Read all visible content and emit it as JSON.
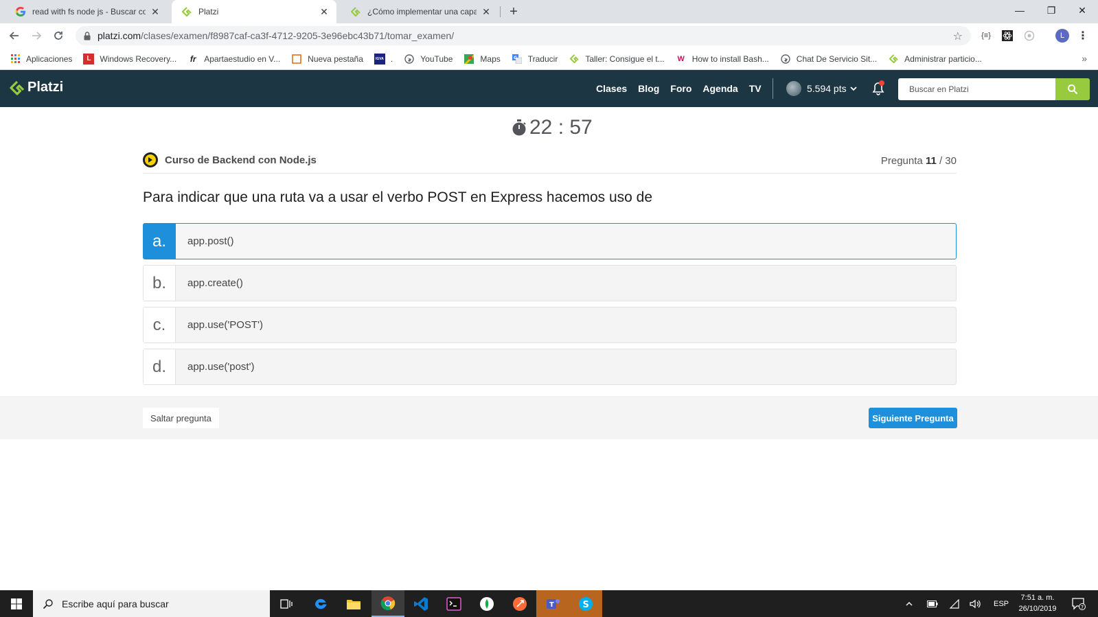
{
  "browser": {
    "tabs": [
      {
        "title": "read with fs node js - Buscar con Google",
        "close": "✕"
      },
      {
        "title": "Platzi",
        "close": "✕"
      },
      {
        "title": "¿Cómo implementar una capa de servicios",
        "close": "✕"
      }
    ],
    "new_tab": "+",
    "window_controls": {
      "minimize": "—",
      "restore": "❐",
      "close": "✕"
    },
    "url_host": "platzi.com",
    "url_path": "/clases/examen/f8987caf-ca3f-4712-9205-3e96ebc43b71/tomar_examen/",
    "profile_initial": "L",
    "extension_label": "{≡}"
  },
  "bookmarks": [
    {
      "label": "Aplicaciones",
      "icon": "apps-grid-icon"
    },
    {
      "label": "Windows Recovery...",
      "icon": "L"
    },
    {
      "label": "Apartaestudio en V...",
      "icon": "fr"
    },
    {
      "label": "Nueva pestaña",
      "icon": "square-icon"
    },
    {
      "label": ".",
      "icon": "IGVA"
    },
    {
      "label": "YouTube",
      "icon": "globe-icon"
    },
    {
      "label": "Maps",
      "icon": "maps-icon"
    },
    {
      "label": "Traducir",
      "icon": "translate-icon"
    },
    {
      "label": "Taller: Consigue el t...",
      "icon": "platzi-icon"
    },
    {
      "label": "How to install Bash...",
      "icon": "W"
    },
    {
      "label": "Chat De Servicio Sit...",
      "icon": "globe-icon"
    },
    {
      "label": "Administrar particio...",
      "icon": "platzi-icon"
    }
  ],
  "bookmarks_more": "»",
  "platzi": {
    "logo": "Platzi",
    "nav": [
      "Clases",
      "Blog",
      "Foro",
      "Agenda",
      "TV"
    ],
    "points": "5.594 pts",
    "search_placeholder": "Buscar en Platzi",
    "brand_color": "#98ca3f",
    "header_color": "#1c3643"
  },
  "exam": {
    "timer": "22 : 57",
    "course": "Curso de Backend con Node.js",
    "question_label": "Pregunta",
    "question_current": "11",
    "question_total": "/ 30",
    "question": "Para indicar que una ruta va a usar el verbo POST en Express hacemos uso de",
    "options": [
      {
        "letter": "a.",
        "text": "app.post()",
        "selected": true
      },
      {
        "letter": "b.",
        "text": "app.create()",
        "selected": false
      },
      {
        "letter": "c.",
        "text": "app.use('POST')",
        "selected": false
      },
      {
        "letter": "d.",
        "text": "app.use('post')",
        "selected": false
      }
    ],
    "skip_label": "Saltar pregunta",
    "next_label": "Siguiente Pregunta",
    "accent_color": "#1d8fdb"
  },
  "taskbar": {
    "search_placeholder": "Escribe aquí para buscar",
    "language": "ESP",
    "time": "7:51 a. m.",
    "date": "26/10/2019",
    "notifications": "7"
  }
}
